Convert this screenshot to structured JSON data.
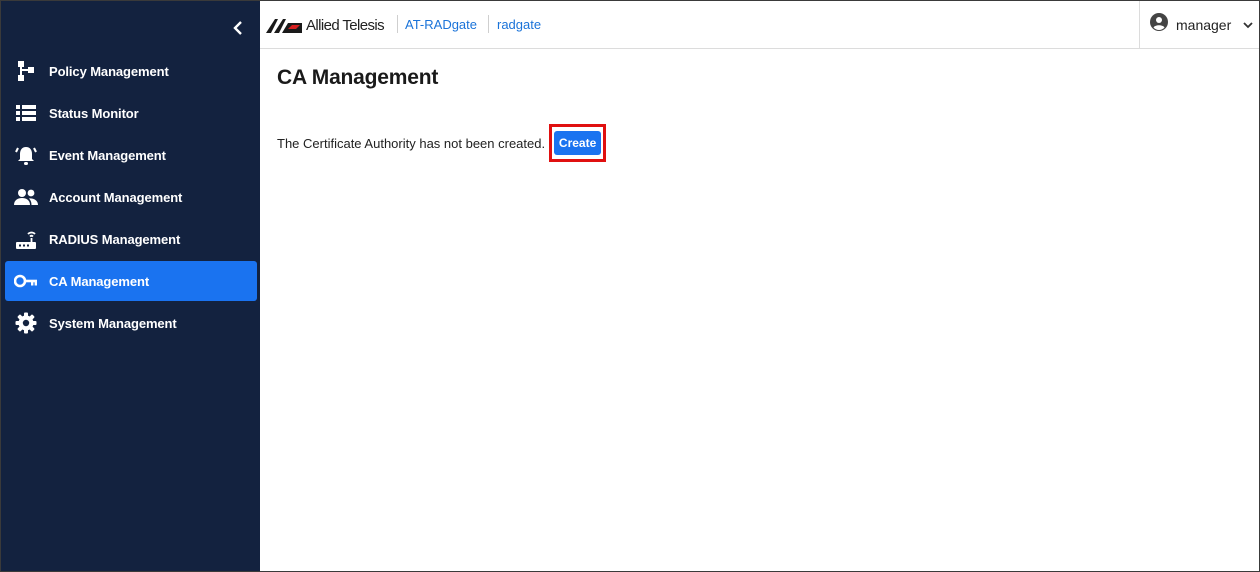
{
  "app": {
    "brand": "Allied Telesis",
    "product": "AT-RADgate",
    "device": "radgate"
  },
  "user": {
    "name": "manager"
  },
  "sidebar": {
    "items": [
      {
        "label": "Policy Management",
        "icon": "policy-tree-icon"
      },
      {
        "label": "Status Monitor",
        "icon": "list-icon"
      },
      {
        "label": "Event Management",
        "icon": "alarm-bell-icon"
      },
      {
        "label": "Account Management",
        "icon": "people-icon"
      },
      {
        "label": "RADIUS Management",
        "icon": "router-icon"
      },
      {
        "label": "CA Management",
        "icon": "key-icon",
        "active": true
      },
      {
        "label": "System Management",
        "icon": "gear-icon"
      }
    ]
  },
  "main": {
    "title": "CA Management",
    "message": "The Certificate Authority has not been created.",
    "create_label": "Create"
  },
  "colors": {
    "sidebar_bg": "#13223f",
    "accent": "#1a73f0",
    "highlight": "#e01010",
    "link": "#1a73d9"
  }
}
